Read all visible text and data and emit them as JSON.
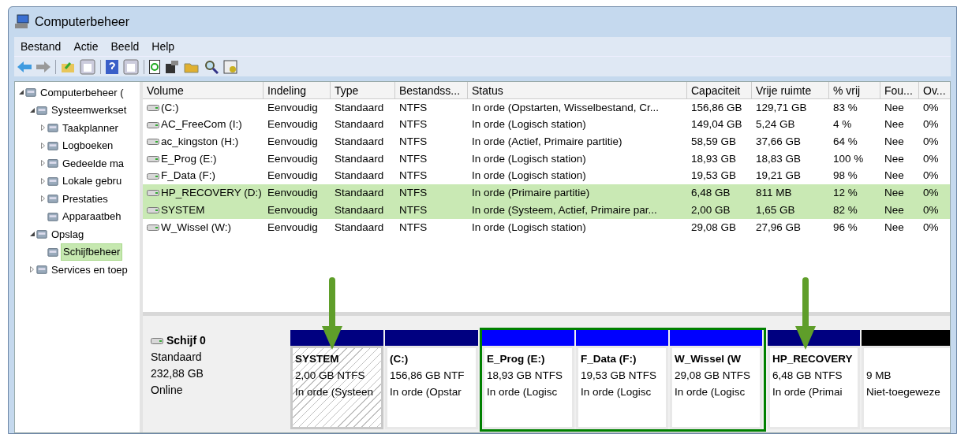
{
  "window": {
    "title": "Computerbeheer"
  },
  "menu": [
    "Bestand",
    "Actie",
    "Beeld",
    "Help"
  ],
  "tree": [
    {
      "label": "Computerbeheer (",
      "expanded": true,
      "selected": false,
      "children": [
        {
          "label": "Systeemwerkset",
          "expanded": true,
          "selected": false,
          "children": [
            {
              "label": "Taakplanner",
              "expanded": false,
              "selected": false
            },
            {
              "label": "Logboeken",
              "expanded": false,
              "selected": false
            },
            {
              "label": "Gedeelde ma",
              "expanded": false,
              "selected": false
            },
            {
              "label": "Lokale gebru",
              "expanded": false,
              "selected": false
            },
            {
              "label": "Prestaties",
              "expanded": false,
              "selected": false
            },
            {
              "label": "Apparaatbeh",
              "selected": false
            }
          ]
        },
        {
          "label": "Opslag",
          "expanded": true,
          "selected": false,
          "children": [
            {
              "label": "Schijfbeheer",
              "selected": true
            }
          ]
        },
        {
          "label": "Services en toep",
          "expanded": false,
          "selected": false
        }
      ]
    }
  ],
  "table": {
    "columns": [
      "Volume",
      "Indeling",
      "Type",
      "Bestandss...",
      "Status",
      "Capaciteit",
      "Vrije ruimte",
      "% vrij",
      "Fou...",
      "Ov..."
    ],
    "rows": [
      {
        "selected": false,
        "cells": [
          " (C:)",
          "Eenvoudig",
          "Standaard",
          "NTFS",
          "In orde (Opstarten, Wisselbestand, Cr...",
          "156,86 GB",
          "129,71 GB",
          "83 %",
          "Nee",
          "0%"
        ]
      },
      {
        "selected": false,
        "cells": [
          "AC_FreeCom (I:)",
          "Eenvoudig",
          "Standaard",
          "NTFS",
          "In orde (Logisch station)",
          "149,04 GB",
          "5,24 GB",
          "4 %",
          "Nee",
          "0%"
        ]
      },
      {
        "selected": false,
        "cells": [
          "ac_kingston (H:)",
          "Eenvoudig",
          "Standaard",
          "NTFS",
          "In orde (Actief, Primaire partitie)",
          "58,59 GB",
          "37,66 GB",
          "64 %",
          "Nee",
          "0%"
        ]
      },
      {
        "selected": false,
        "cells": [
          "E_Prog (E:)",
          "Eenvoudig",
          "Standaard",
          "NTFS",
          "In orde (Logisch station)",
          "18,93 GB",
          "18,83 GB",
          "100 %",
          "Nee",
          "0%"
        ]
      },
      {
        "selected": false,
        "cells": [
          "F_Data (F:)",
          "Eenvoudig",
          "Standaard",
          "NTFS",
          "In orde (Logisch station)",
          "19,53 GB",
          "19,21 GB",
          "98 %",
          "Nee",
          "0%"
        ]
      },
      {
        "selected": true,
        "cells": [
          "HP_RECOVERY (D:)",
          "Eenvoudig",
          "Standaard",
          "NTFS",
          "In orde (Primaire partitie)",
          "6,48 GB",
          "811 MB",
          "12 %",
          "Nee",
          "0%"
        ]
      },
      {
        "selected": true,
        "cells": [
          "SYSTEM",
          "Eenvoudig",
          "Standaard",
          "NTFS",
          "In orde (Systeem, Actief, Primaire par...",
          "2,00 GB",
          "1,65 GB",
          "82 %",
          "Nee",
          "0%"
        ]
      },
      {
        "selected": false,
        "cells": [
          "W_Wissel (W:)",
          "Eenvoudig",
          "Standaard",
          "NTFS",
          "In orde (Logisch station)",
          "29,08 GB",
          "27,96 GB",
          "96 %",
          "Nee",
          "0%"
        ]
      }
    ]
  },
  "disk": {
    "name": "Schijf 0",
    "type": "Standaard",
    "size": "232,88 GB",
    "state": "Online",
    "partitions": [
      {
        "kind": "primary",
        "selected": true,
        "name": "SYSTEM",
        "size": "2,00 GB NTFS",
        "status": "In orde (Systeen"
      },
      {
        "kind": "primary",
        "selected": false,
        "name": "(C:)",
        "size": "156,86 GB NTF",
        "status": "In orde (Opstar"
      },
      {
        "kind": "logical",
        "selected": false,
        "name": "E_Prog  (E:)",
        "size": "18,93 GB NTFS",
        "status": "In orde (Logisc"
      },
      {
        "kind": "logical",
        "selected": false,
        "name": "F_Data  (F:)",
        "size": "19,53 GB NTFS",
        "status": "In orde (Logisc"
      },
      {
        "kind": "logical",
        "selected": false,
        "name": "W_Wissel  (W",
        "size": "29,08 GB NTFS",
        "status": "In orde (Logisc"
      },
      {
        "kind": "primary",
        "selected": false,
        "name": "HP_RECOVERY",
        "size": "6,48 GB NTFS",
        "status": "In orde (Primai"
      },
      {
        "kind": "unallocated",
        "selected": false,
        "size": "9 MB",
        "status": "Niet-toegeweze"
      }
    ]
  }
}
